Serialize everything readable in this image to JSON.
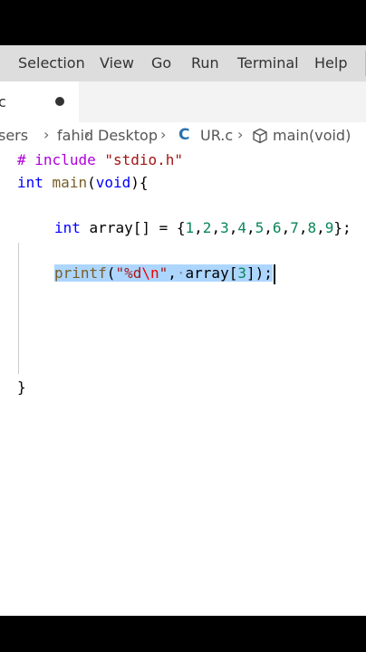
{
  "menubar": {
    "items": [
      "Selection",
      "View",
      "Go",
      "Run",
      "Terminal",
      "Help"
    ]
  },
  "tab": {
    "label": "c"
  },
  "breadcrumb": {
    "parts": [
      "sers",
      "fahid",
      "Desktop",
      "UR.c",
      "main(void)"
    ],
    "file_icon": "C"
  },
  "code": {
    "line1": {
      "hash": "#",
      "directive": "include",
      "header": "\"stdio.h\""
    },
    "line2": {
      "type": "int",
      "name": "main",
      "open": "(",
      "param": "void",
      "close": "){"
    },
    "line3": {
      "type": "int",
      "decl": "array[] = {",
      "nums": [
        "1",
        "2",
        "3",
        "4",
        "5",
        "6",
        "7",
        "8",
        "9"
      ],
      "end": "};"
    },
    "line4": {
      "fn": "printf",
      "open": "(",
      "str_start": "\"",
      "fmt": "%d",
      "esc": "\\n",
      "str_end": "\"",
      "sep": ",",
      "dot": "·",
      "arg": "array[",
      "idx": "3",
      "close": "]);"
    },
    "line5": {
      "brace": "}"
    }
  },
  "colors": {
    "keyword": "#0000ff",
    "string": "#a31515",
    "number": "#098658",
    "function": "#795e26",
    "selection": "#add6ff"
  }
}
